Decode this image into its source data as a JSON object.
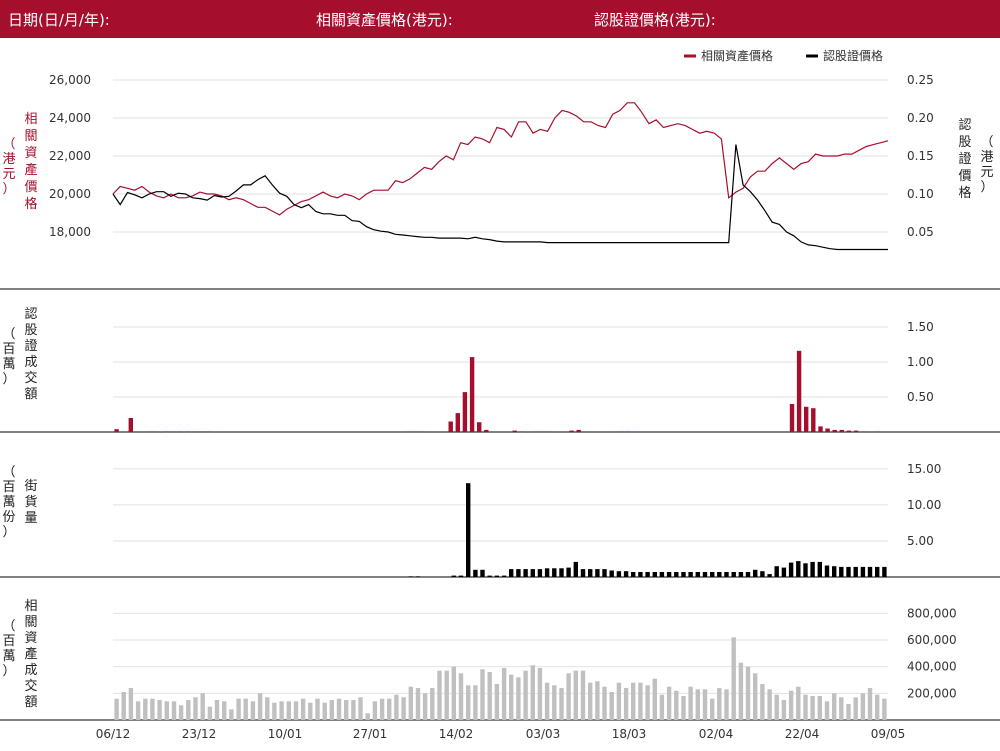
{
  "header": {
    "date_label": "日期(日/月/年):",
    "underlying_label": "相關資產價格(港元):",
    "warrant_label": "認股證價格(港元):"
  },
  "colors": {
    "brand": "#a50f2d",
    "underlying": "#a50f2d",
    "warrant": "#000000",
    "street_bar": "#000000",
    "turnover_bar": "#c0c0c0",
    "grid": "#e2e2e2"
  },
  "legend": {
    "underlying": "相關資產價格",
    "warrant": "認股證價格"
  },
  "chart_data": [
    {
      "type": "line",
      "panel": "price",
      "y_left_label": "相關資產價格",
      "y_left_unit": "（港元）",
      "y_right_label": "認股證價格",
      "y_right_unit": "（港元）",
      "y_left_ticks": [
        "26,000",
        "24,000",
        "22,000",
        "20,000",
        "18,000"
      ],
      "y_right_ticks": [
        "0.25",
        "0.20",
        "0.15",
        "0.10",
        "0.05"
      ],
      "y_left_range": [
        16000,
        26000
      ],
      "y_right_range": [
        0,
        0.25
      ],
      "grid": true,
      "legend_position": "top-right",
      "series": [
        {
          "name": "相關資產價格",
          "axis": "left",
          "values": [
            20000,
            20400,
            20300,
            20200,
            20400,
            20100,
            19900,
            19800,
            20000,
            19800,
            19800,
            19900,
            20100,
            20000,
            20000,
            19900,
            19700,
            19800,
            19700,
            19500,
            19300,
            19300,
            19100,
            18900,
            19200,
            19400,
            19600,
            19700,
            19900,
            20100,
            19900,
            19800,
            20000,
            19900,
            19700,
            20000,
            20200,
            20200,
            20200,
            20700,
            20600,
            20800,
            21100,
            21400,
            21300,
            21700,
            22000,
            21800,
            22700,
            22600,
            23000,
            22900,
            22700,
            23500,
            23400,
            23000,
            23800,
            23800,
            23200,
            23400,
            23300,
            24000,
            24400,
            24300,
            24100,
            23800,
            23800,
            23600,
            23500,
            24200,
            24400,
            24800,
            24800,
            24300,
            23700,
            23900,
            23500,
            23600,
            23700,
            23600,
            23400,
            23200,
            23300,
            23200,
            22900,
            19800,
            20100,
            20300,
            20900,
            21200,
            21200,
            21600,
            21900,
            21600,
            21300,
            21600,
            21700,
            22100,
            22000,
            22000,
            22000,
            22100,
            22100,
            22300,
            22500,
            22600,
            22700,
            22800
          ]
        },
        {
          "name": "認股證價格",
          "axis": "right",
          "values": [
            0.1,
            0.086,
            0.102,
            0.099,
            0.095,
            0.1,
            0.103,
            0.103,
            0.097,
            0.101,
            0.1,
            0.095,
            0.094,
            0.092,
            0.098,
            0.096,
            0.097,
            0.104,
            0.112,
            0.112,
            0.119,
            0.124,
            0.112,
            0.101,
            0.097,
            0.086,
            0.082,
            0.086,
            0.077,
            0.074,
            0.074,
            0.072,
            0.072,
            0.065,
            0.064,
            0.057,
            0.053,
            0.051,
            0.05,
            0.047,
            0.046,
            0.045,
            0.044,
            0.043,
            0.043,
            0.042,
            0.042,
            0.042,
            0.042,
            0.041,
            0.043,
            0.041,
            0.04,
            0.038,
            0.037,
            0.037,
            0.037,
            0.037,
            0.037,
            0.037,
            0.036,
            0.036,
            0.036,
            0.036,
            0.036,
            0.036,
            0.036,
            0.036,
            0.036,
            0.036,
            0.036,
            0.036,
            0.036,
            0.036,
            0.036,
            0.036,
            0.036,
            0.036,
            0.036,
            0.036,
            0.036,
            0.036,
            0.036,
            0.036,
            0.036,
            0.036,
            0.165,
            0.112,
            0.103,
            0.092,
            0.078,
            0.063,
            0.06,
            0.05,
            0.045,
            0.037,
            0.033,
            0.032,
            0.03,
            0.028,
            0.027,
            0.027,
            0.027,
            0.027,
            0.027,
            0.027,
            0.027,
            0.027
          ]
        }
      ]
    },
    {
      "type": "bar",
      "panel": "warrant_turnover",
      "y_label": "認股證成交額",
      "y_unit": "（百萬）",
      "y_ticks": [
        "1.50",
        "1.00",
        "0.50"
      ],
      "y_range": [
        0,
        1.8
      ],
      "values": [
        0.04,
        0,
        0.2,
        0,
        0,
        0.01,
        0,
        0.01,
        0.01,
        0.01,
        0.01,
        0.01,
        0.01,
        0.01,
        0,
        0,
        0,
        0,
        0,
        0,
        0,
        0,
        0,
        0,
        0,
        0,
        0,
        0,
        0,
        0,
        0,
        0,
        0,
        0,
        0,
        0,
        0,
        0,
        0,
        0,
        0,
        0.01,
        0.01,
        0.01,
        0,
        0,
        0,
        0.15,
        0.27,
        0.57,
        1.07,
        0.14,
        0.03,
        0,
        0,
        0,
        0.02,
        0.01,
        0,
        0.01,
        0.01,
        0.01,
        0,
        0,
        0.02,
        0.03,
        0,
        0,
        0,
        0,
        0,
        0.01,
        0.01,
        0,
        0,
        0,
        0,
        0,
        0,
        0,
        0,
        0,
        0,
        0,
        0,
        0,
        0,
        0,
        0,
        0,
        0,
        0,
        0,
        0,
        0,
        0.4,
        1.16,
        0.36,
        0.34,
        0.08,
        0.05,
        0.03,
        0.03,
        0.02,
        0.02,
        0.01,
        0,
        0.01,
        0
      ]
    },
    {
      "type": "bar",
      "panel": "street_quantity",
      "y_label": "街貨量",
      "y_unit": "（百萬份）",
      "y_ticks": [
        "15.00",
        "10.00",
        "5.00"
      ],
      "y_range": [
        0,
        16.5
      ],
      "values": [
        0,
        0,
        0,
        0,
        0,
        0,
        0,
        0,
        0,
        0,
        0,
        0,
        0,
        0,
        0,
        0,
        0,
        0,
        0,
        0,
        0,
        0,
        0,
        0,
        0,
        0,
        0,
        0,
        0,
        0,
        0,
        0,
        0,
        0,
        0,
        0,
        0,
        0,
        0,
        0,
        0,
        0.1,
        0.1,
        0,
        0,
        0,
        0,
        0.2,
        0.2,
        13.0,
        1.0,
        1.0,
        0.2,
        0.2,
        0.2,
        1.1,
        1.1,
        1.1,
        1.1,
        1.1,
        1.2,
        1.2,
        1.2,
        1.3,
        2.1,
        1.1,
        1.1,
        1.1,
        1.1,
        0.9,
        0.8,
        0.8,
        0.7,
        0.7,
        0.7,
        0.7,
        0.7,
        0.7,
        0.7,
        0.7,
        0.7,
        0.7,
        0.7,
        0.7,
        0.7,
        0.7,
        0.7,
        0.7,
        0.7,
        1.0,
        0.8,
        0.4,
        1.5,
        1.3,
        2.0,
        2.2,
        1.9,
        2.1,
        2.1,
        1.6,
        1.5,
        1.4,
        1.4,
        1.4,
        1.4,
        1.4,
        1.4,
        1.4
      ]
    },
    {
      "type": "bar",
      "panel": "underlying_turnover",
      "y_label": "相關資產成交額",
      "y_unit": "（百萬）",
      "y_ticks": [
        "800,000",
        "600,000",
        "400,000",
        "200,000"
      ],
      "y_range": [
        0,
        900000
      ],
      "values": [
        160000,
        210000,
        240000,
        140000,
        160000,
        160000,
        150000,
        140000,
        140000,
        110000,
        150000,
        170000,
        200000,
        100000,
        150000,
        140000,
        80000,
        160000,
        160000,
        140000,
        200000,
        170000,
        130000,
        140000,
        140000,
        140000,
        160000,
        130000,
        160000,
        130000,
        150000,
        160000,
        150000,
        150000,
        170000,
        50000,
        140000,
        160000,
        160000,
        190000,
        170000,
        250000,
        240000,
        200000,
        240000,
        370000,
        370000,
        400000,
        350000,
        260000,
        260000,
        380000,
        360000,
        270000,
        390000,
        340000,
        320000,
        370000,
        410000,
        390000,
        280000,
        260000,
        240000,
        350000,
        370000,
        370000,
        280000,
        290000,
        250000,
        210000,
        280000,
        240000,
        280000,
        280000,
        260000,
        310000,
        190000,
        250000,
        220000,
        180000,
        250000,
        230000,
        230000,
        160000,
        240000,
        230000,
        620000,
        430000,
        400000,
        350000,
        270000,
        230000,
        190000,
        150000,
        220000,
        250000,
        190000,
        180000,
        180000,
        140000,
        200000,
        170000,
        120000,
        170000,
        200000,
        240000,
        190000,
        160000
      ]
    }
  ],
  "x_axis": {
    "ticks": [
      "06/12",
      "23/12",
      "10/01",
      "27/01",
      "14/02",
      "03/03",
      "18/03",
      "02/04",
      "22/04",
      "09/05"
    ]
  }
}
